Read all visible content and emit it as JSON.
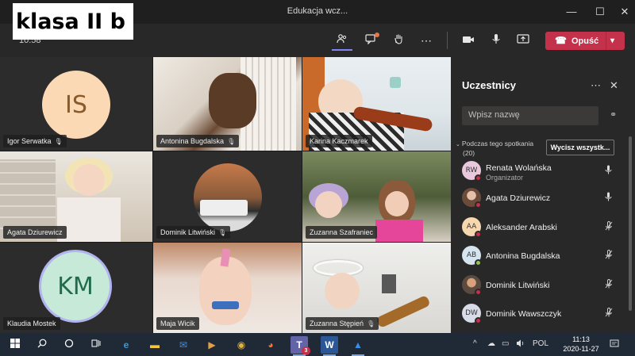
{
  "window": {
    "title": "Edukacja wcz...",
    "overlay_label": "klasa II b",
    "minimize": "—",
    "maximize": "☐",
    "close": "✕"
  },
  "controls": {
    "timer": "10:58",
    "participants_icon": "people-icon",
    "chat_icon": "chat-icon",
    "raise_hand_icon": "hand-icon",
    "more_icon": "⋯",
    "camera_icon": "camera-icon",
    "mic_icon": "mic-icon",
    "share_icon": "share-icon",
    "leave_label": "Opuść",
    "accent": "#c4314b"
  },
  "tiles": [
    {
      "name": "Igor Serwatka",
      "initials": "IS",
      "kind": "avatar",
      "avatar_bg": "#fbd9b4",
      "avatar_fg": "#8a5a2b"
    },
    {
      "name": "Antonina Bugdalska",
      "kind": "video"
    },
    {
      "name": "Karina Kaczmarek",
      "kind": "video"
    },
    {
      "name": "Agata Dziurewicz",
      "kind": "video"
    },
    {
      "name": "Dominik Litwiński",
      "kind": "video"
    },
    {
      "name": "Zuzanna Szafranieс",
      "kind": "video"
    },
    {
      "name": "Klaudia Mostek",
      "initials": "KM",
      "kind": "avatar",
      "avatar_bg": "#c7e9d8",
      "avatar_fg": "#1f6b4a"
    },
    {
      "name": "Maja Wicik",
      "kind": "video"
    },
    {
      "name": "Zuzanna Stępień",
      "kind": "video"
    }
  ],
  "panel": {
    "title": "Uczestnicy",
    "more": "⋯",
    "close": "✕",
    "search_placeholder": "Wpisz nazwę",
    "section_label_1": "Podczas tego spotkania",
    "section_label_2": "(20)",
    "mute_all": "Wycisz wszystk...",
    "participants": [
      {
        "name": "Renata Wolańska",
        "role": "Organizator",
        "initials": "RW",
        "avatar_bg": "#e8c8dd",
        "status": "#92c353",
        "mic": "mic-on"
      },
      {
        "name": "Agata Dziurewicz",
        "role": "",
        "initials": "",
        "avatar_bg": "#8a6b5a",
        "status": "#c4314b",
        "mic": "mic-on"
      },
      {
        "name": "Aleksander Arabski",
        "role": "",
        "initials": "AA",
        "avatar_bg": "#f7d7b0",
        "status": "#c4314b",
        "mic": "mic-off"
      },
      {
        "name": "Antonina Bugdalska",
        "role": "",
        "initials": "AB",
        "avatar_bg": "#d6e4f0",
        "status": "#92c353",
        "mic": "mic-off"
      },
      {
        "name": "Dominik Litwiński",
        "role": "",
        "initials": "",
        "avatar_bg": "#7a5b4a",
        "status": "#c4314b",
        "mic": "mic-off"
      },
      {
        "name": "Dominik Wawszczyk",
        "role": "",
        "initials": "DW",
        "avatar_bg": "#d8dbe8",
        "status": "#c4314b",
        "mic": "mic-off"
      }
    ]
  },
  "taskbar": {
    "start_icon": "windows-icon",
    "search_icon": "search-icon",
    "cortana_icon": "circle-icon",
    "taskview_icon": "taskview-icon",
    "apps": [
      {
        "icon": "edge-icon",
        "glyph": "e",
        "color": "#2e9ee6"
      },
      {
        "icon": "folder-icon",
        "glyph": "▬",
        "color": "#f2c53d"
      },
      {
        "icon": "mail-icon",
        "glyph": "✉",
        "color": "#3a8ee6"
      },
      {
        "icon": "media-icon",
        "glyph": "▶",
        "color": "#e0a04a"
      },
      {
        "icon": "chrome-icon",
        "glyph": "◉",
        "color": "#e0b43a"
      },
      {
        "icon": "firefox-icon",
        "glyph": "◕",
        "color": "#ff7139"
      },
      {
        "icon": "teams-icon",
        "glyph": "T",
        "color": "#6264a7",
        "badge": "3"
      },
      {
        "icon": "word-icon",
        "glyph": "W",
        "color": "#2b5797"
      },
      {
        "icon": "photos-icon",
        "glyph": "▲",
        "color": "#3a8ee6"
      }
    ],
    "tray": {
      "chevron": "^",
      "onedrive": "☁",
      "network": "▭",
      "volume": "🔈",
      "language": "POL",
      "time": "11:13",
      "date": "2020-11-27"
    }
  }
}
